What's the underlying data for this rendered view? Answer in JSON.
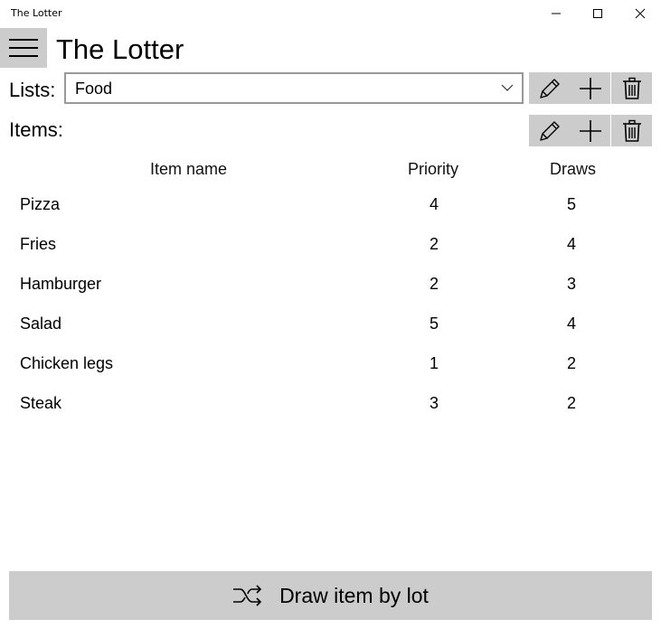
{
  "window": {
    "title": "The Lotter",
    "icons": [
      "minimize-icon",
      "maximize-icon",
      "close-icon"
    ]
  },
  "header": {
    "menu_icon": "hamburger-icon",
    "app_title": "The Lotter"
  },
  "lists": {
    "label": "Lists:",
    "selected": "Food",
    "actions": [
      "edit-icon",
      "add-icon",
      "delete-icon"
    ]
  },
  "items": {
    "label": "Items:",
    "actions": [
      "edit-icon",
      "add-icon",
      "delete-icon"
    ],
    "columns": {
      "name": "Item name",
      "priority": "Priority",
      "draws": "Draws"
    },
    "rows": [
      {
        "name": "Pizza",
        "priority": "4",
        "draws": "5"
      },
      {
        "name": "Fries",
        "priority": "2",
        "draws": "4"
      },
      {
        "name": "Hamburger",
        "priority": "2",
        "draws": "3"
      },
      {
        "name": "Salad",
        "priority": "5",
        "draws": "4"
      },
      {
        "name": "Chicken legs",
        "priority": "1",
        "draws": "2"
      },
      {
        "name": "Steak",
        "priority": "3",
        "draws": "2"
      }
    ]
  },
  "draw_button": {
    "icon": "shuffle-icon",
    "label": "Draw item by lot"
  }
}
